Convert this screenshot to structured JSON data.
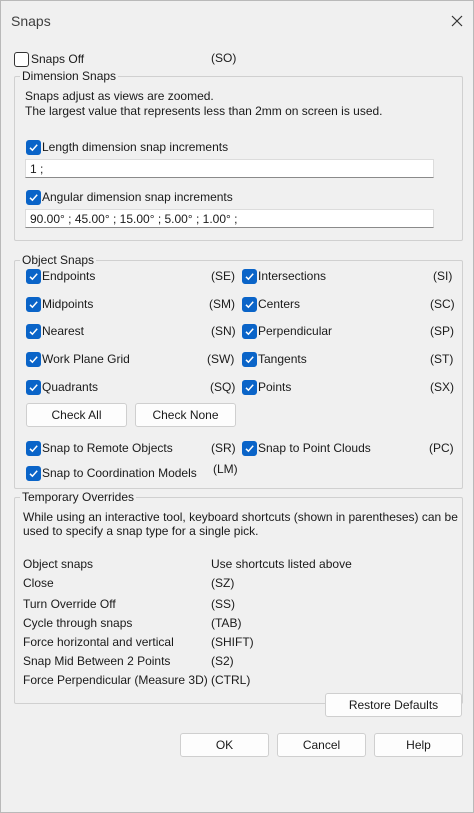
{
  "window": {
    "title": "Snaps"
  },
  "snaps_off": {
    "label": "Snaps Off",
    "shortcut": "(SO)",
    "checked": false
  },
  "dimension_snaps": {
    "title": "Dimension Snaps",
    "description_line1": "Snaps adjust as views are zoomed.",
    "description_line2": "The largest value that represents less than 2mm on screen is used.",
    "length": {
      "label": "Length dimension snap increments",
      "checked": true,
      "value": "1 ;"
    },
    "angular": {
      "label": "Angular dimension snap increments",
      "checked": true,
      "value": "90.00° ; 45.00° ; 15.00° ; 5.00° ; 1.00° ;"
    }
  },
  "object_snaps": {
    "title": "Object Snaps",
    "left": [
      {
        "label": "Endpoints",
        "shortcut": "(SE)"
      },
      {
        "label": "Midpoints",
        "shortcut": "(SM)"
      },
      {
        "label": "Nearest",
        "shortcut": "(SN)"
      },
      {
        "label": "Work Plane Grid",
        "shortcut": "(SW)"
      },
      {
        "label": "Quadrants",
        "shortcut": "(SQ)"
      }
    ],
    "right": [
      {
        "label": "Intersections",
        "shortcut": "(SI)"
      },
      {
        "label": "Centers",
        "shortcut": "(SC)"
      },
      {
        "label": "Perpendicular",
        "shortcut": "(SP)"
      },
      {
        "label": "Tangents",
        "shortcut": "(ST)"
      },
      {
        "label": "Points",
        "shortcut": "(SX)"
      }
    ],
    "check_all": "Check All",
    "check_none": "Check None",
    "remote": {
      "label": "Snap to Remote Objects",
      "shortcut": "(SR)"
    },
    "point_clouds": {
      "label": "Snap to Point Clouds",
      "shortcut": "(PC)"
    },
    "coordination": {
      "label": "Snap to Coordination Models",
      "shortcut": "(LM)"
    }
  },
  "temporary_overrides": {
    "title": "Temporary Overrides",
    "description_line1": "While using an interactive tool, keyboard shortcuts (shown in parentheses) can be",
    "description_line2": "used to specify a snap type for a single pick.",
    "rows": [
      {
        "label": "Object snaps",
        "value": "Use shortcuts listed above"
      },
      {
        "label": "Close",
        "value": "(SZ)"
      },
      {
        "label": "Turn Override Off",
        "value": "(SS)"
      },
      {
        "label": "Cycle through snaps",
        "value": "(TAB)"
      },
      {
        "label": "Force horizontal and vertical",
        "value": "(SHIFT)"
      },
      {
        "label": "Snap Mid Between 2 Points",
        "value": "(S2)"
      },
      {
        "label": "Force Perpendicular (Measure 3D)",
        "value": "(CTRL)"
      }
    ]
  },
  "buttons": {
    "restore_defaults": "Restore Defaults",
    "ok": "OK",
    "cancel": "Cancel",
    "help": "Help"
  },
  "colors": {
    "accent": "#0a64c8",
    "background": "#f0f0f0"
  }
}
